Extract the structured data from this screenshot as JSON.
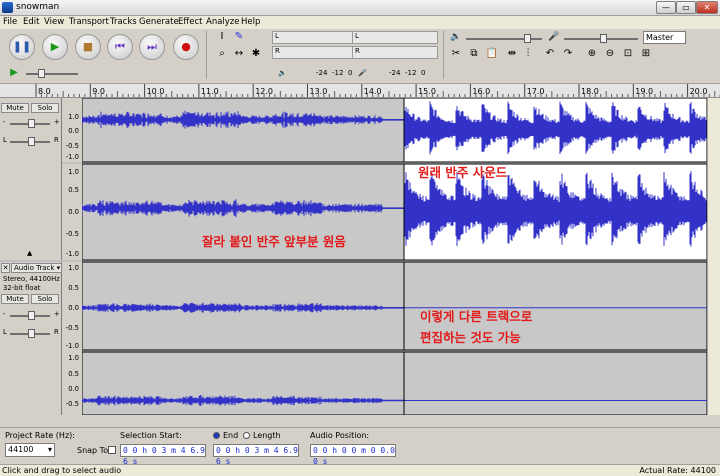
{
  "window": {
    "title": "snowman",
    "controls": {
      "minimize": "—",
      "maximize": "▭",
      "close": "✕"
    }
  },
  "menu": [
    "File",
    "Edit",
    "View",
    "Transport",
    "Tracks",
    "Generate",
    "Effect",
    "Analyze",
    "Help"
  ],
  "transport": {
    "pause": "❚❚",
    "play": "▶",
    "stop": "■",
    "skip_start": "⏮",
    "skip_end": "⏭",
    "record": "●"
  },
  "tools": [
    "I",
    "✎",
    "⌕",
    "↔",
    "✱"
  ],
  "meters": {
    "play_ticks": [
      "-24",
      "-12",
      "0"
    ],
    "rec_ticks": [
      "-24",
      "-12",
      "0"
    ],
    "channel_L": "L",
    "channel_R": "R"
  },
  "mixer": {
    "device": "Master"
  },
  "ruler": {
    "ticks": [
      "8.0",
      "9.0",
      "10.0",
      "11.0",
      "12.0",
      "13.0",
      "14.0",
      "15.0",
      "16.0",
      "17.0",
      "18.0",
      "19.0",
      "20.0"
    ]
  },
  "tracks": [
    {
      "mute": "Mute",
      "solo": "Solo",
      "gain_minus": "-",
      "gain_plus": "+",
      "pan_left": "L",
      "pan_right": "R",
      "collapse": "▲",
      "scale_top": [
        "1.0",
        "0.5",
        "0.0",
        "-0.5",
        "-1.0"
      ],
      "scale_bottom": [
        "1.0",
        "0.5",
        "0.0",
        "-0.5",
        "-1.0"
      ]
    },
    {
      "close": "✕",
      "name": "Audio Track",
      "info_1": "Stereo, 44100Hz",
      "info_2": "32-bit float",
      "mute": "Mute",
      "solo": "Solo",
      "gain_minus": "-",
      "gain_plus": "+",
      "pan_left": "L",
      "pan_right": "R",
      "scale_top": [
        "1.0",
        "0.5",
        "0.0",
        "-0.5",
        "-1.0"
      ],
      "scale_bottom": [
        "1.0",
        "0.5",
        "0.0",
        "-0.5",
        "-1.0"
      ]
    }
  ],
  "annotations": {
    "orig_accompaniment": "원래 반주 사운드",
    "cut_paste": "잘라 붙인 반주 앞부분 원음",
    "other_track_1": "이렇게 다른 트랙으로",
    "other_track_2": "편집하는 것도 가능"
  },
  "selection_bar": {
    "project_rate_label": "Project Rate (Hz):",
    "project_rate": "44100",
    "snap_to": "Snap To",
    "selection_start_label": "Selection Start:",
    "selection_start": "0 0 h 0 3 m 4 6.9 6 s",
    "end_label": "End",
    "length_label": "Length",
    "selection_end": "0 0 h 0 3 m 4 6.9 6 s",
    "audio_position_label": "Audio Position:",
    "audio_position": "0 0 h 0 0 m 0 0.0 0 s"
  },
  "status": {
    "left": "Click and drag to select audio",
    "right": "Actual Rate: 44100"
  },
  "colors": {
    "wave": "#3232c8",
    "wave_bg": "#c8c8c8",
    "wave_bg_selected": "#ffffff",
    "annotation": "#e21a1a"
  }
}
